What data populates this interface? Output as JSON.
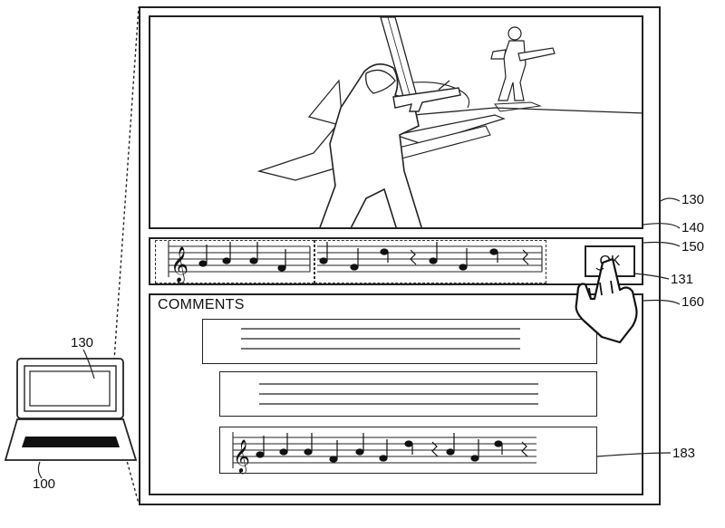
{
  "refs": {
    "laptop": "100",
    "laptop_screen": "130",
    "display": "130",
    "game_view": "140",
    "music_bar": "150",
    "ok_button_ref": "131",
    "comments_panel": "160",
    "music_comment": "183"
  },
  "ok_button": {
    "label": "OK"
  },
  "comments": {
    "title": "COMMENTS",
    "items": [
      {
        "type": "text"
      },
      {
        "type": "text"
      },
      {
        "type": "music"
      }
    ]
  },
  "icons": [
    "treble-clef-icon",
    "hand-pointer-icon",
    "laptop-icon"
  ]
}
